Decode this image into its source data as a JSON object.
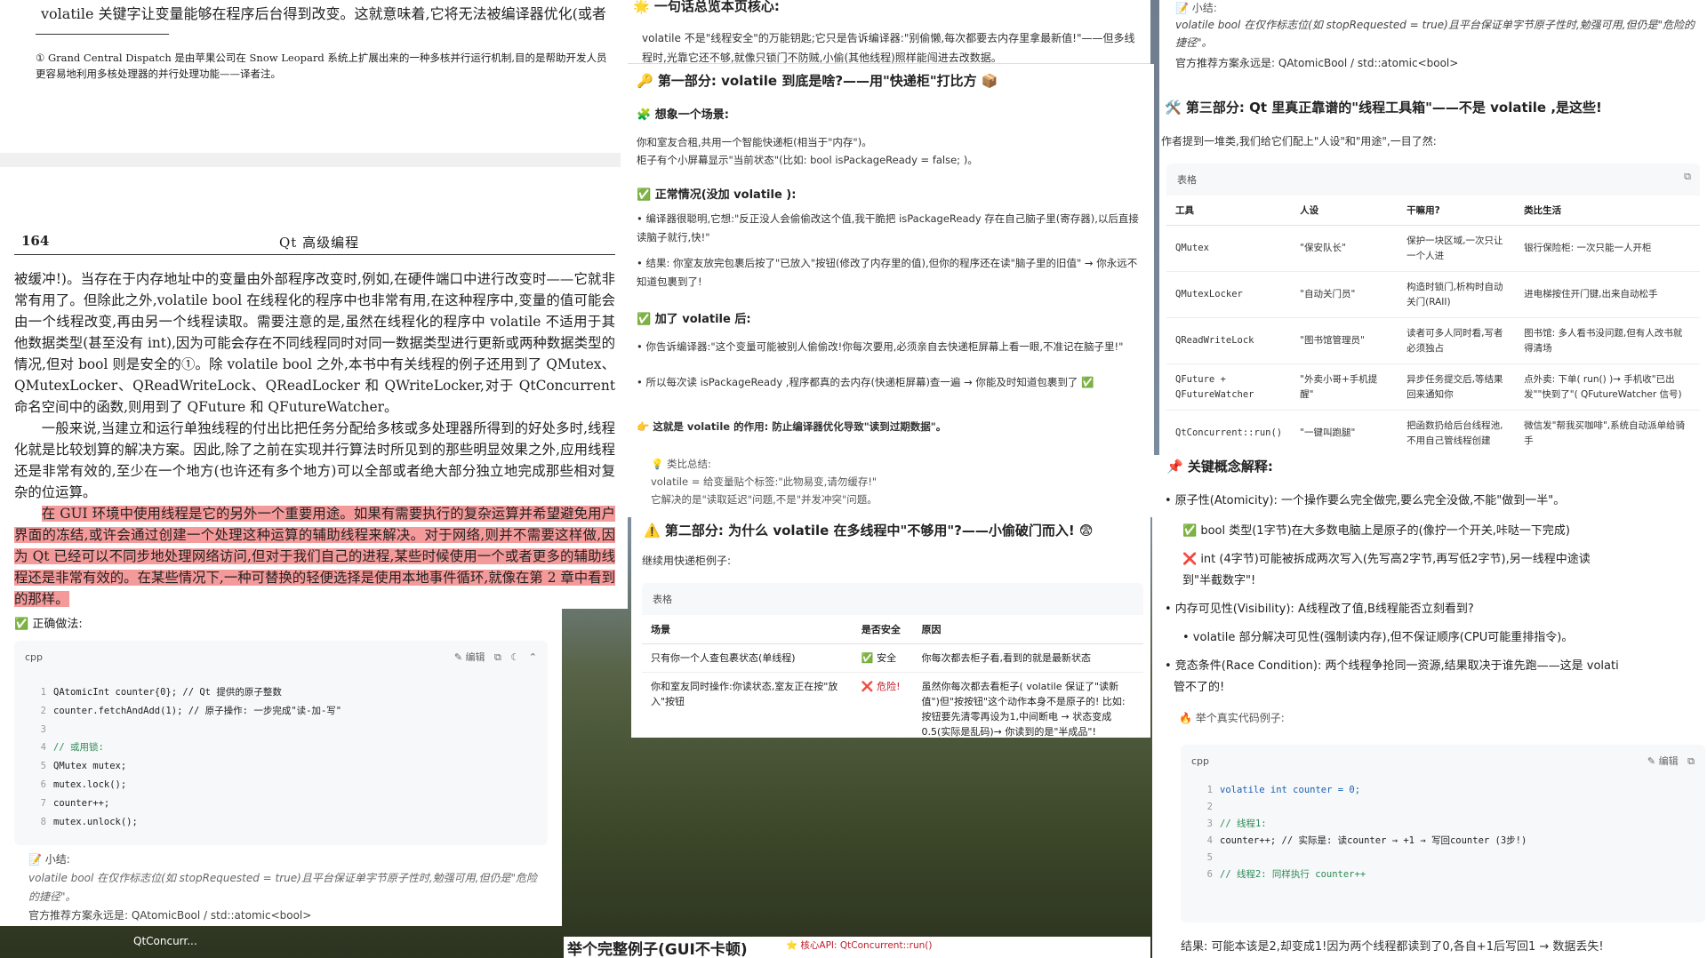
{
  "book": {
    "top_frag": "volatile 关键字让变量能够在程序后台得到改变。这就意味着,它将无法被编译器优化(或者",
    "footnote": "① Grand Central Dispatch 是由苹果公司在 Snow Leopard 系统上扩展出来的一种多核并行运行机制,目的是帮助开发人员更容易地利用多核处理器的并行处理功能——译者注。",
    "page_number": "164",
    "page_title": "Qt 高级编程",
    "para1": "被缓冲!)。当存在于内存地址中的变量由外部程序改变时,例如,在硬件端口中进行改变时——它就非常有用了。但除此之外,volatile bool 在线程化的程序中也非常有用,在这种程序中,变量的值可能会由一个线程改变,再由另一个线程读取。需要注意的是,虽然在线程化的程序中 volatile 不适用于其他数据类型(甚至没有 int),因为可能会存在不同线程同时对同一数据类型进行更新或两种数据类型的情况,但对 bool 则是安全的①。除 volatile bool 之外,本书中有关线程的例子还用到了 QMutex、QMutexLocker、QReadWriteLock、QReadLocker 和 QWriteLocker,对于 QtConcurrent 命名空间中的函数,则用到了 QFuture 和 QFutureWatcher。",
    "para2": "一般来说,当建立和运行单独线程的付出比把任务分配给多核或多处理器所得到的好处多时,线程化就是比较划算的解决方案。因此,除了之前在实现并行算法时所见到的那些明显效果之外,应用线程还是非常有效的,至少在一个地方(也许还有多个地方)可以全部或者绝大部分独立地完成那些相对复杂的位运算。",
    "para3": "在 GUI 环境中使用线程是它的另外一个重要用途。如果有需要执行的复杂运算并希望避免用户界面的冻结,或许会通过创建一个处理这种运算的辅助线程来解决。对于网络,则并不需要这样做,因为 Qt 已经可以不同步地处理网络访问,但对于我们自己的进程,某些时候使用一个或者更多的辅助线程还是非常有效的。在某些情况下,一种可替换的轻便选择是使用本地事件循环,就像在第 2 章中看到的那样。"
  },
  "code_left": {
    "title": "✅ 正确做法:",
    "lang": "cpp",
    "edit_label": "编辑",
    "lines": [
      "QAtomicInt counter{0};  // Qt 提供的原子整数",
      "counter.fetchAndAdd(1); // 原子操作: 一步完成\"读-加-写\"",
      "",
      "// 或用锁:",
      "QMutex mutex;",
      "mutex.lock();",
      "counter++;",
      "mutex.unlock();"
    ],
    "summary_head": "📝 小结:",
    "summary_line": "volatile bool 在仅作标志位(如 stopRequested = true)且平台保证单字节原子性时,勉强可用,但仍是\"危险的捷径\"。",
    "summary_rec": "官方推荐方案永远是: QAtomicBool / std::atomic<bool>"
  },
  "mid_top": {
    "title": "🌟 一句话总览本页核心:",
    "text": "volatile 不是\"线程安全\"的万能钥匙;它只是告诉编译器:\"别偷懒,每次都要去内存里拿最新值!\"——但多线程时,光靠它还不够,就像只锁门不防贼,小偷(其他线程)照样能闯进去改数据。"
  },
  "part1": {
    "title": "🔑 第一部分: volatile 到底是啥?——用\"快递柜\"打比方 📦",
    "scene_title": "🧩 想象一个场景:",
    "scene_p1": "你和室友合租,共用一个智能快递柜(相当于\"内存\")。",
    "scene_p2": "柜子有个小屏幕显示\"当前状态\"(比如: bool isPackageReady = false; )。",
    "normal_title": "✅ 正常情况(没加 volatile ):",
    "normal_b1": "• 编译器很聪明,它想:\"反正没人会偷偷改这个值,我干脆把 isPackageReady 存在自己脑子里(寄存器),以后直接读脑子就行,快!\"",
    "normal_b2": "• 结果: 你室友放完包裹后按了\"已放入\"按钮(修改了内存里的值),但你的程序还在读\"脑子里的旧值\" → 你永远不知道包裹到了!",
    "added_title": "✅ 加了 volatile 后:",
    "added_b1": "• 你告诉编译器:\"这个变量可能被别人偷偷改!你每次要用,必须亲自去快递柜屏幕上看一眼,不准记在脑子里!\"",
    "added_b2": "• 所以每次读 isPackageReady ,程序都真的去内存(快递柜屏幕)查一遍 → 你能及时知道包裹到了 ✅",
    "effect": "👉 这就是 volatile 的作用: 防止编译器优化导致\"读到过期数据\"。",
    "note_head": "💡 类比总结:",
    "note_l1": "volatile = 给变量贴个标签:\"此物易变,请勿缓存!\"",
    "note_l2": "它解决的是\"读取延迟\"问题,不是\"并发冲突\"问题。"
  },
  "part2": {
    "title": "⚠️ 第二部分: 为什么 volatile 在多线程中\"不够用\"?——小偷破门而入! 😨",
    "lead": "继续用快递柜例子:",
    "table_caption": "表格",
    "headers": [
      "场景",
      "是否安全",
      "原因"
    ],
    "rows": [
      [
        "只有你一个人查包裹状态(单线程)",
        "✅ 安全",
        "你每次都去柜子看,看到的就是最新状态"
      ],
      [
        "你和室友同时操作:你读状态,室友正在按\"放入\"按钮",
        "❌ 危险!",
        "虽然你每次都去看柜子( volatile 保证了\"读新值\")但\"按按钮\"这个动作本身不是原子的! 比如: 按钮要先清零再设为1,中间断电 → 状态变成0.5(实际是乱码)→ 你读到的是\"半成品\"!"
      ]
    ]
  },
  "bottom": {
    "label": "QtConcurr...",
    "title": "举个完整例子(GUI不卡顿)",
    "sub": "⭐ 核心API: QtConcurrent::run()"
  },
  "right_top": {
    "head": "📝 小结:",
    "line": "volatile bool 在仅作标志位(如 stopRequested = true)且平台保证单字节原子性时,勉强可用,但仍是\"危险的捷径\"。",
    "rec": "官方推荐方案永远是: QAtomicBool / std::atomic<bool>"
  },
  "part3": {
    "title": "🛠️ 第三部分: Qt 里真正靠谱的\"线程工具箱\"——不是 volatile ,是这些!",
    "lead": "作者提到一堆类,我们给它们配上\"人设\"和\"用途\",一目了然:",
    "table_caption": "表格",
    "headers": [
      "工具",
      "人设",
      "干嘛用?",
      "类比生活"
    ],
    "rows": [
      [
        "QMutex",
        "\"保安队长\"",
        "保护一块区域,一次只让一个人进",
        "银行保险柜: 一次只能一人开柜"
      ],
      [
        "QMutexLocker",
        "\"自动关门员\"",
        "构造时锁门,析构时自动关门(RAII)",
        "进电梯按住开门键,出来自动松手"
      ],
      [
        "QReadWriteLock",
        "\"图书馆管理员\"",
        "读者可多人同时看,写者必须独占",
        "图书馆: 多人看书没问题,但有人改书就得清场"
      ],
      [
        "QFuture + QFutureWatcher",
        "\"外卖小哥+手机提醒\"",
        "异步任务提交后,等结果回来通知你",
        "点外卖: 下单( run() )→ 手机收\"已出发\"\"快到了\"( QFutureWatcher 信号)"
      ],
      [
        "QtConcurrent::run()",
        "\"一键叫跑腿\"",
        "把函数扔给后台线程池,不用自己管线程创建",
        "微信发\"帮我买咖啡\",系统自动派单给骑手"
      ]
    ]
  },
  "part4": {
    "title": "📌 关键概念解释:",
    "atomicity": "• 原子性(Atomicity): 一个操作要么完全做完,要么完全没做,不能\"做到一半\"。",
    "atom_ok": "✅ bool 类型(1字节)在大多数电脑上是原子的(像拧一个开关,咔哒一下完成)",
    "atom_bad1": "❌ int (4字节)可能被拆成两次写入(先写高2字节,再写低2字节),另一线程中途读",
    "atom_bad2": "到\"半截数字\"!",
    "visibility": "• 内存可见性(Visibility): A线程改了值,B线程能否立刻看到?",
    "vis_sub": "• volatile 部分解决可见性(强制读内存),但不保证顺序(CPU可能重排指令)。",
    "race1": "• 竞态条件(Race Condition): 两个线程争抢同一资源,结果取决于谁先跑——这是 volati",
    "race2": "管不了的!",
    "example_head": "🔥 举个真实代码例子:",
    "lang": "cpp",
    "edit_label": "编辑",
    "lines": [
      "volatile int counter = 0;",
      "",
      "// 线程1:",
      "counter++;  // 实际是: 读counter → +1 → 写回counter (3步!)",
      "",
      "// 线程2: 同样执行 counter++"
    ],
    "result": "结果: 可能本该是2,却变成1!因为两个线程都读到了0,各自+1后写回1 → 数据丢失!"
  }
}
